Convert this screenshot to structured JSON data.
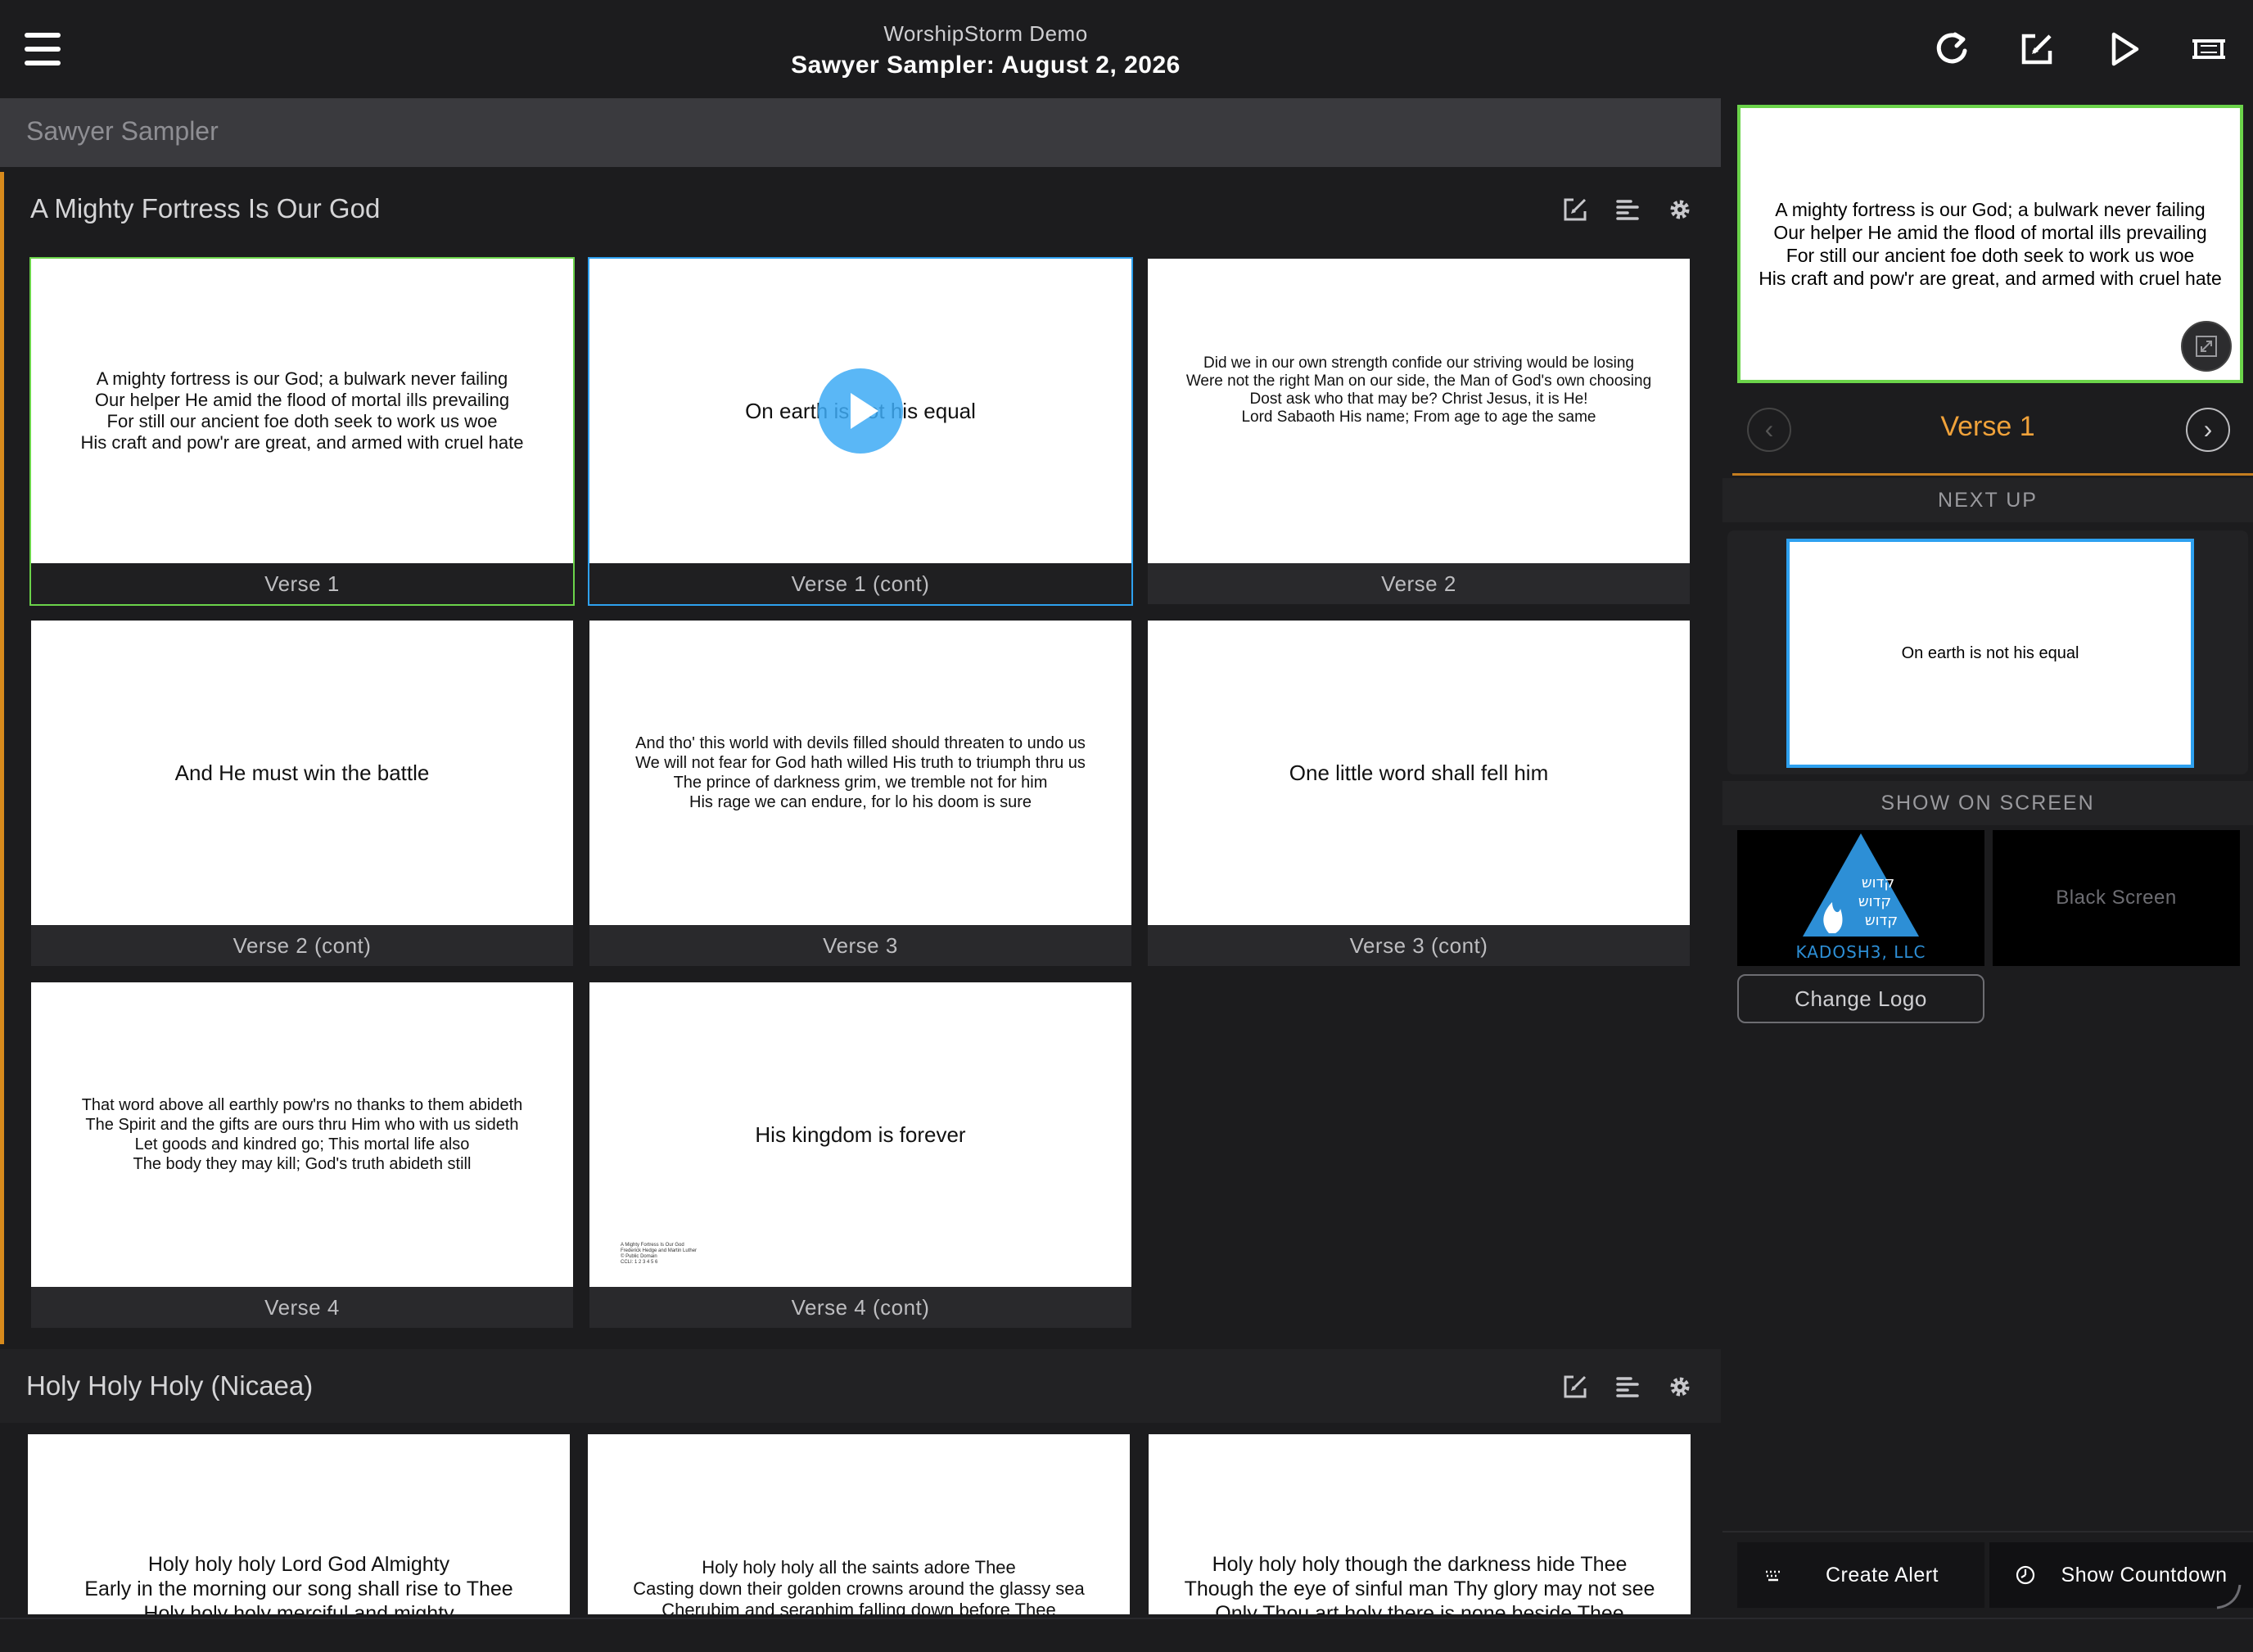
{
  "header": {
    "app_name": "WorshipStorm Demo",
    "set_title": "Sawyer Sampler: August 2, 2026",
    "icons": [
      "menu-icon",
      "refresh-icon",
      "edit-icon",
      "play-icon",
      "screen-icon"
    ]
  },
  "set": {
    "name": "Sawyer Sampler"
  },
  "songs": [
    {
      "title": "A Mighty Fortress Is Our God",
      "tools": [
        "edit-icon",
        "arrange-icon",
        "settings-icon"
      ],
      "slides": [
        {
          "label": "Verse 1",
          "state": "live",
          "lines": [
            "A mighty fortress is our God; a bulwark never failing",
            "Our helper He amid the flood of mortal ills prevailing",
            "For still our ancient foe doth seek to work us woe",
            "His craft and pow'r are great, and armed with cruel hate"
          ]
        },
        {
          "label": "Verse 1 (cont)",
          "state": "next",
          "lines": [
            "On earth is not his equal"
          ]
        },
        {
          "label": "Verse 2",
          "state": "",
          "lines": [
            "Did we in our own strength confide our striving would be losing",
            "Were not the right Man on our side, the Man of God's own choosing",
            "Dost ask who that may be? Christ Jesus, it is He!",
            "Lord Sabaoth His name; From age to age the same"
          ]
        },
        {
          "label": "Verse 2 (cont)",
          "state": "",
          "lines": [
            "And He must win the battle"
          ]
        },
        {
          "label": "Verse 3",
          "state": "",
          "lines": [
            "And tho' this world with devils filled should threaten to undo us",
            "We will not fear for God hath willed His truth to triumph thru us",
            "The prince of darkness grim, we tremble not for him",
            "His rage we can endure, for lo his doom is sure"
          ]
        },
        {
          "label": "Verse 3 (cont)",
          "state": "",
          "lines": [
            "One little word shall fell him"
          ]
        },
        {
          "label": "Verse 4",
          "state": "",
          "lines": [
            "That word above all earthly pow'rs no thanks to them abideth",
            "The Spirit and the gifts are ours thru Him who with us sideth",
            "Let goods and kindred go; This mortal life also",
            "The body they may kill; God's truth abideth still"
          ]
        },
        {
          "label": "Verse 4 (cont)",
          "state": "",
          "lines": [
            "His kingdom is forever"
          ],
          "credits": [
            "A Mighty Fortress Is Our God",
            "Frederick Hedge and Martin Luther",
            "© Public Domain",
            "CCLI: 1 2 3 4 5 6"
          ]
        }
      ]
    },
    {
      "title": "Holy Holy Holy (Nicaea)",
      "tools": [
        "edit-icon",
        "arrange-icon",
        "settings-icon"
      ],
      "slides": [
        {
          "lines": [
            "Holy holy holy Lord God Almighty",
            "Early in the morning our song shall rise to Thee",
            "Holy holy holy merciful and mighty"
          ]
        },
        {
          "lines": [
            "Holy holy holy all the saints adore Thee",
            "Casting down their golden crowns around the glassy sea",
            "Cherubim and seraphim falling down before Thee"
          ]
        },
        {
          "lines": [
            "Holy holy holy though the darkness hide Thee",
            "Though the eye of sinful man Thy glory may not see",
            "Only Thou art holy there is none beside Thee"
          ]
        }
      ]
    }
  ],
  "panel": {
    "live_lines": [
      "A mighty fortress is our God; a bulwark never failing",
      "Our helper He amid the flood of mortal ills prevailing",
      "For still our ancient foe doth seek to work us woe",
      "His craft and pow'r are great, and armed with cruel hate"
    ],
    "current_label": "Verse 1",
    "prev_glyph": "‹",
    "next_glyph": "›",
    "next_up_heading": "NEXT UP",
    "next_up_text": "On earth is not his equal",
    "show_on_screen_heading": "SHOW ON SCREEN",
    "logo_text": "KADOSH3, LLC",
    "logo_hebrew": [
      "קדוש",
      "קדוש",
      "קדוש"
    ],
    "black_screen_label": "Black Screen",
    "change_logo_label": "Change Logo",
    "create_alert_label": "Create Alert",
    "show_countdown_label": "Show Countdown"
  },
  "colors": {
    "live_border": "#6bd34a",
    "next_border": "#2ea1f0",
    "accent_orange": "#f0a23a",
    "background": "#1c1c1e"
  }
}
